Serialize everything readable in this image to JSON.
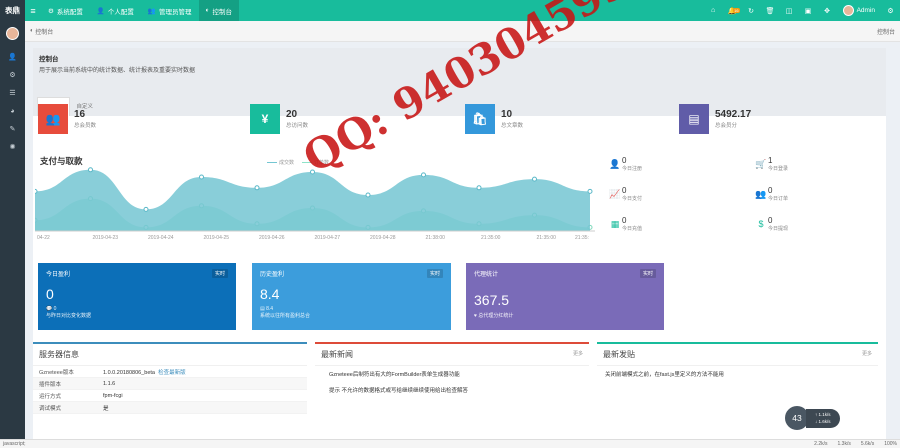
{
  "app": {
    "logo": "表鼎",
    "admin": "Admin",
    "notif_count": "16"
  },
  "nav": [
    {
      "icon": "gear-icon",
      "label": "系统配置"
    },
    {
      "icon": "user-icon",
      "label": "个人配置"
    },
    {
      "icon": "users-icon",
      "label": "管理员管理"
    },
    {
      "icon": "dashboard-icon",
      "label": "控制台"
    }
  ],
  "crumb": {
    "left": "控制台",
    "right": "控制台"
  },
  "page": {
    "title": "控制台",
    "desc": "用于展示当前系统中的统计数据、统计报表及重要实时数据",
    "tabs": [
      "控制台",
      "自定义"
    ]
  },
  "stats": [
    {
      "num": "16",
      "label": "总会员数",
      "color": "#e74c3c",
      "icon": "users-icon",
      "glyph": "👥"
    },
    {
      "num": "20",
      "label": "总访问数",
      "color": "#18bc9c",
      "icon": "yen-icon",
      "glyph": "¥"
    },
    {
      "num": "10",
      "label": "总文章数",
      "color": "#3498db",
      "icon": "bag-icon",
      "glyph": "🛍"
    },
    {
      "num": "5492.17",
      "label": "总会员分",
      "color": "#605ca8",
      "icon": "book-icon",
      "glyph": "▤"
    }
  ],
  "chart_data": {
    "type": "area",
    "title": "支付与取款",
    "series": [
      {
        "name": "成交数",
        "values": [
          55,
          85,
          30,
          75,
          60,
          82,
          50,
          78,
          60,
          72,
          55
        ]
      },
      {
        "name": "订单数",
        "values": [
          15,
          45,
          5,
          35,
          10,
          32,
          5,
          28,
          10,
          22,
          5
        ]
      }
    ],
    "x": [
      "04-22",
      "2019-04-23",
      "2019-04-24",
      "2019-04-25",
      "2019-04-26",
      "2019-04-27",
      "2019-04-28",
      "21:38:00",
      "21:35:00",
      "21:35:00",
      "21:35:"
    ],
    "colors": [
      "#74c6d2",
      "#8fe3c9"
    ]
  },
  "rstats": [
    {
      "num": "0",
      "label": "今日注册"
    },
    {
      "num": "1",
      "label": "今日登录"
    },
    {
      "num": "0",
      "label": "今日支付"
    },
    {
      "num": "0",
      "label": "今日订单"
    },
    {
      "num": "0",
      "label": "今日充值"
    },
    {
      "num": "0",
      "label": "今日提现"
    }
  ],
  "cards": [
    {
      "title": "今日盈利",
      "tag": "实时",
      "num": "0",
      "sub1": "0",
      "sub2": "与昨日对比变化数据",
      "color": "#0c6fb8"
    },
    {
      "title": "历史盈利",
      "tag": "实时",
      "num": "8.4",
      "sub1": "8.4",
      "sub2": "系统以往所有盈利总合",
      "color": "#3c9ddc"
    },
    {
      "title": "代理统计",
      "tag": "实时",
      "num": "367.5",
      "sub1": "",
      "sub2": "总代理分红统计",
      "color": "#7a6bb8"
    }
  ],
  "server": {
    "title": "服务器信息",
    "rows": [
      {
        "k": "Gzneteee版本",
        "v": "1.0.0.20180806_beta",
        "link": "检查最新版"
      },
      {
        "k": "插件版本",
        "v": "1.1.6",
        "link": ""
      },
      {
        "k": "运行方式",
        "v": "fpm-fcgi",
        "link": ""
      },
      {
        "k": "调试模式",
        "v": "是",
        "link": ""
      }
    ]
  },
  "newsbox": {
    "title": "最新新闻",
    "more": "更多",
    "items": [
      "Gzneteee后制符出有大的FormBuilder表单生成器功能",
      "提示 不允许的数据格式或写给继续继续使用给出检查解答"
    ]
  },
  "posts": {
    "title": "最新发贴",
    "more": "更多",
    "items": [
      "关闭前端模式之前，在fast.js里定义的方法不能用"
    ]
  },
  "watermark": "QQ: 940304595",
  "status": {
    "left": "javascript;",
    "right": [
      "2.2k/s",
      "1.3k/s",
      "5.6k/s",
      "100%"
    ]
  },
  "gauge": {
    "num": "43",
    "up": "1.1k/s",
    "down": "1.6k/s"
  }
}
